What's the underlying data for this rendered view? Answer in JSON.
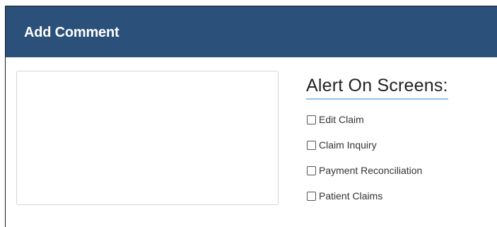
{
  "dialog": {
    "title": "Add Comment",
    "header_color": "#2b5079"
  },
  "comment": {
    "value": "",
    "placeholder": ""
  },
  "alert": {
    "heading": "Alert On Screens:",
    "underline_color": "#8fc3ec",
    "options": [
      {
        "label": "Edit Claim",
        "checked": false
      },
      {
        "label": "Claim Inquiry",
        "checked": false
      },
      {
        "label": "Payment Reconciliation",
        "checked": false
      },
      {
        "label": "Patient Claims",
        "checked": false
      }
    ]
  }
}
